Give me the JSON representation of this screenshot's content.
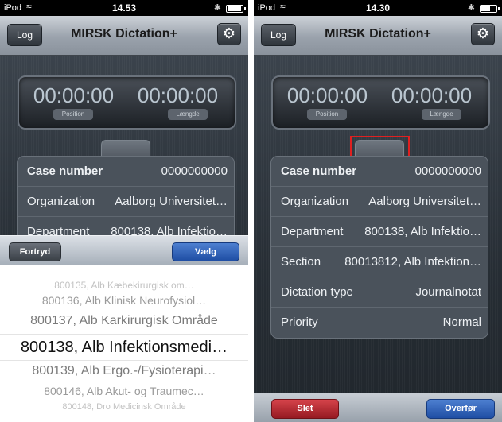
{
  "left": {
    "status": {
      "carrier": "iPod",
      "time": "14.53",
      "battery_level": 0.95
    },
    "nav": {
      "title": "MIRSK Dictation+",
      "log_label": "Log"
    },
    "timer": {
      "position": "00:00:00",
      "position_label": "Position",
      "length": "00:00:00",
      "length_label": "Længde"
    },
    "rows": [
      {
        "label": "Case number",
        "value": "0000000000"
      },
      {
        "label": "Organization",
        "value": "Aalborg Universitet…"
      },
      {
        "label": "Department",
        "value": "800138, Alb Infektio…"
      }
    ],
    "toolbar": {
      "cancel": "Fortryd",
      "confirm": "Vælg"
    },
    "picker": [
      "800135, Alb Kæbekirurgisk om…",
      "800136, Alb Klinisk Neurofysiol…",
      "800137, Alb Karkirurgisk Område",
      "800138, Alb Infektionsmedi…",
      "800139, Alb Ergo.-/Fysioterapi…",
      "800146, Alb Akut- og Traumec…",
      "800148, Dro Medicinsk Område"
    ]
  },
  "right": {
    "status": {
      "carrier": "iPod",
      "time": "14.30",
      "battery_level": 0.6
    },
    "nav": {
      "title": "MIRSK Dictation+",
      "log_label": "Log"
    },
    "timer": {
      "position": "00:00:00",
      "position_label": "Position",
      "length": "00:00:00",
      "length_label": "Længde"
    },
    "rows": [
      {
        "label": "Case number",
        "value": "0000000000"
      },
      {
        "label": "Organization",
        "value": "Aalborg Universitet…"
      },
      {
        "label": "Department",
        "value": "800138, Alb Infektio…"
      },
      {
        "label": "Section",
        "value": "80013812, Alb Infektion…"
      },
      {
        "label": "Dictation type",
        "value": "Journalnotat"
      },
      {
        "label": "Priority",
        "value": "Normal"
      }
    ],
    "bottom": {
      "delete": "Slet",
      "transfer": "Overfør"
    }
  },
  "colors": {
    "highlight": "#e02020",
    "confirm_blue": "#1f4ea4",
    "delete_red": "#961a22"
  },
  "icons": {
    "wifi": "wifi-icon",
    "bluetooth": "bluetooth-icon",
    "battery": "battery-icon",
    "settings": "gear-icon"
  }
}
